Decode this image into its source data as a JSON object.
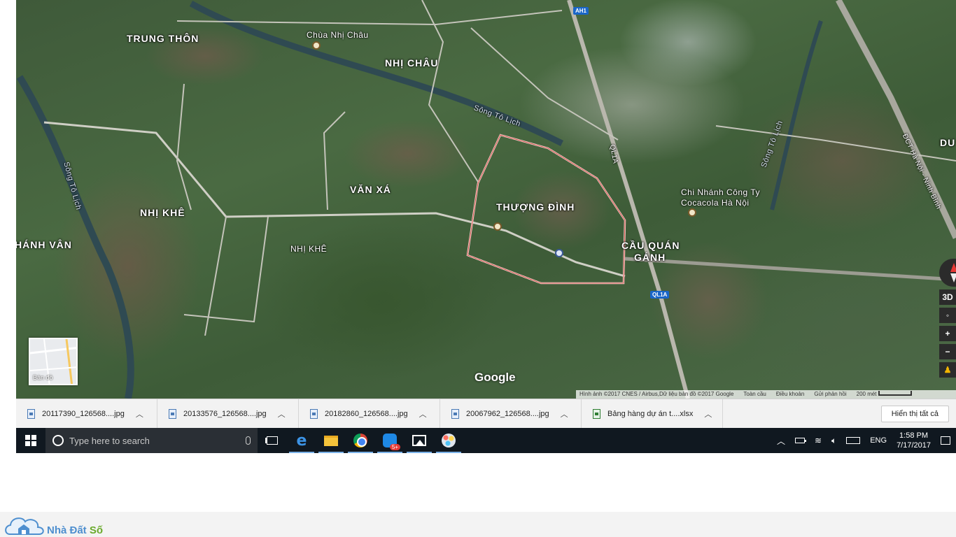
{
  "map": {
    "labels": {
      "trung_thon": "TRUNG THÔN",
      "chua_nhi_chau": "Chùa Nhị Châu",
      "nhi_chau": "NHỊ CHÂU",
      "song_to_lich_1": "Sông Tô Lịch",
      "song_to_lich_2": "Sông Tô Lịch",
      "song_to_lich_3": "Sông Tô Lịch",
      "van_xa": "VĂN XÁ",
      "nhi_khe_1": "NHỊ KHÊ",
      "nhi_khe_2": "NHỊ KHÊ",
      "hanh_van": "HÁNH VÂN",
      "thuong_dinh": "THƯỢNG ĐÌNH",
      "cau_quan": "CẦU QUÁN",
      "ganh": "GÁNH",
      "cocacola_1": "Chi Nhánh Công Ty",
      "cocacola_2": "Cocacola Hà Nội",
      "ql1a": "QL1A",
      "dct": "ĐCT Hà Nội - Ninh Bình",
      "du": "DU"
    },
    "shields": {
      "ah1": "AH1",
      "ql1a": "QL1A"
    },
    "google": "Google",
    "minimap_label": "Bản đồ",
    "controls": {
      "three_d": "3D",
      "zoom_in": "+",
      "zoom_out": "−"
    },
    "attribution": {
      "imagery": "Hình ảnh ©2017 CNES / Airbus,Dữ liệu bản đồ ©2017 Google",
      "fullscreen": "Toàn cầu",
      "terms": "Điều khoản",
      "feedback": "Gửi phản hồi",
      "scale": "200 mét"
    }
  },
  "downloads": {
    "items": [
      {
        "name": "20117390_126568....jpg",
        "type": "jpg"
      },
      {
        "name": "20133576_126568....jpg",
        "type": "jpg"
      },
      {
        "name": "20182860_126568....jpg",
        "type": "jpg"
      },
      {
        "name": "20067962_126568....jpg",
        "type": "jpg"
      },
      {
        "name": "Bảng hàng dự án t....xlsx",
        "type": "xlsx"
      }
    ],
    "show_all": "Hiển thị tất cả"
  },
  "taskbar": {
    "search_placeholder": "Type here to search",
    "zalo_badge": "5+",
    "language": "ENG",
    "time": "1:58 PM",
    "date": "7/17/2017"
  },
  "brand": {
    "name_part1": "Nhà Đất ",
    "name_part2": "Số"
  }
}
